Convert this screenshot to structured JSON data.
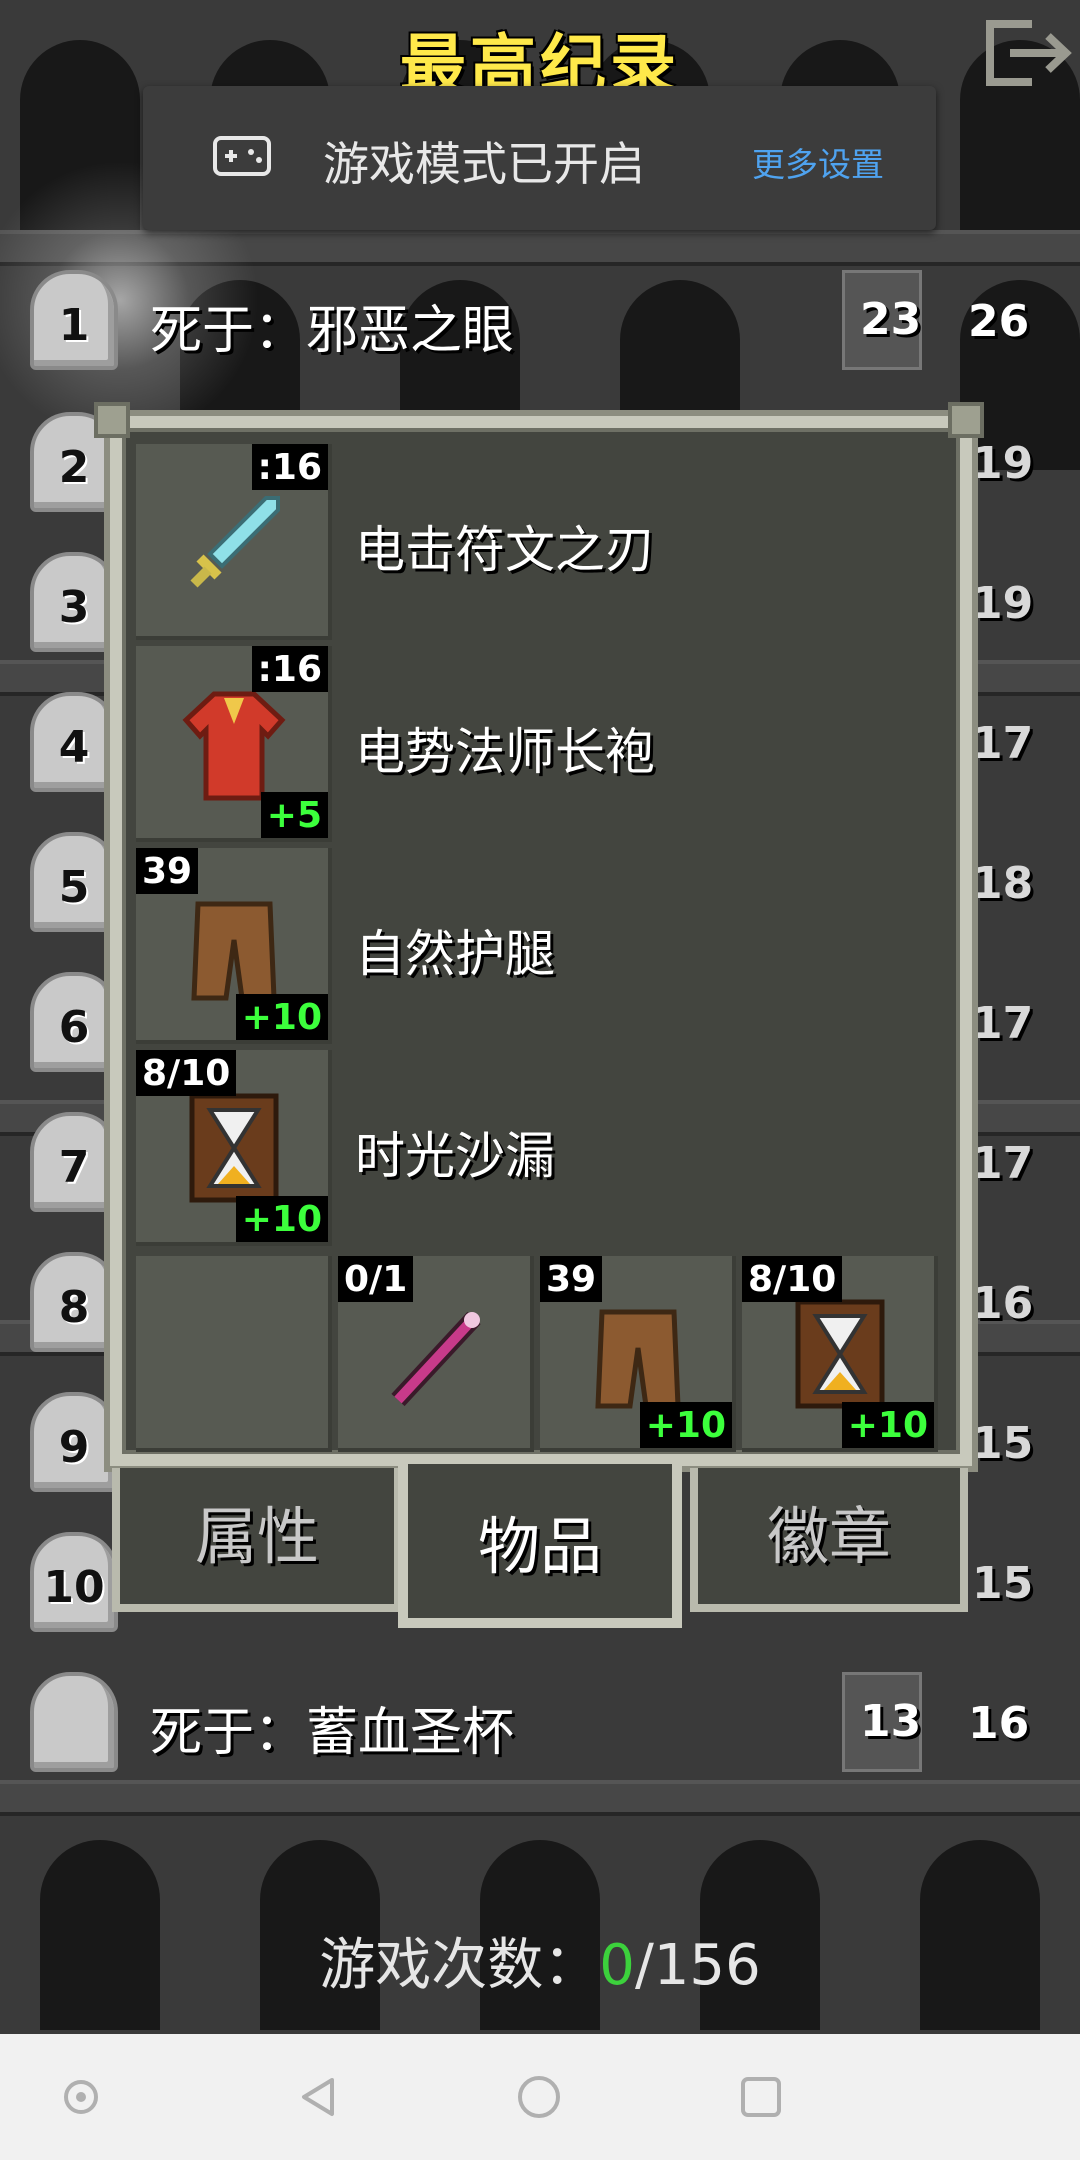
{
  "header": {
    "title": "最高纪录"
  },
  "toast": {
    "message": "游戏模式已开启",
    "more_settings": "更多设置"
  },
  "records": [
    {
      "rank": "1",
      "cause": "死于：邪恶之眼",
      "depth": "23",
      "level": "26"
    },
    {
      "rank": "",
      "cause": "死于：蓄血圣杯",
      "depth": "13",
      "level": "16"
    }
  ],
  "side_ranks": [
    "2",
    "3",
    "4",
    "5",
    "6",
    "7",
    "8",
    "9",
    "10"
  ],
  "side_levels": [
    "19",
    "19",
    "17",
    "18",
    "17",
    "17",
    "16",
    "15",
    "15"
  ],
  "items": [
    {
      "name": "电击符文之刃",
      "tl": "",
      "tr": ":16",
      "br": "",
      "icon": "sword-icon"
    },
    {
      "name": "电势法师长袍",
      "tl": "",
      "tr": ":16",
      "br": "+5",
      "icon": "robe-icon"
    },
    {
      "name": "自然护腿",
      "tl": "39",
      "tr": "",
      "br": "+10",
      "icon": "leggings-icon"
    },
    {
      "name": "时光沙漏",
      "tl": "8/10",
      "tr": "",
      "br": "+10",
      "icon": "hourglass-icon"
    }
  ],
  "quickslots": [
    {
      "tl": "",
      "br": "",
      "icon": "empty"
    },
    {
      "tl": "0/1",
      "br": "",
      "icon": "wand-icon"
    },
    {
      "tl": "39",
      "br": "+10",
      "icon": "leggings-icon"
    },
    {
      "tl": "8/10",
      "br": "+10",
      "icon": "hourglass-icon"
    }
  ],
  "tabs": {
    "stats": "属性",
    "items": "物品",
    "badges": "徽章"
  },
  "games": {
    "label": "游戏次数：",
    "played": "0",
    "total": "/156"
  },
  "colors": {
    "title": "#ffe94a",
    "link": "#4fa3f0",
    "bonus": "#3cff3c",
    "counter_green": "#3cd13c"
  }
}
